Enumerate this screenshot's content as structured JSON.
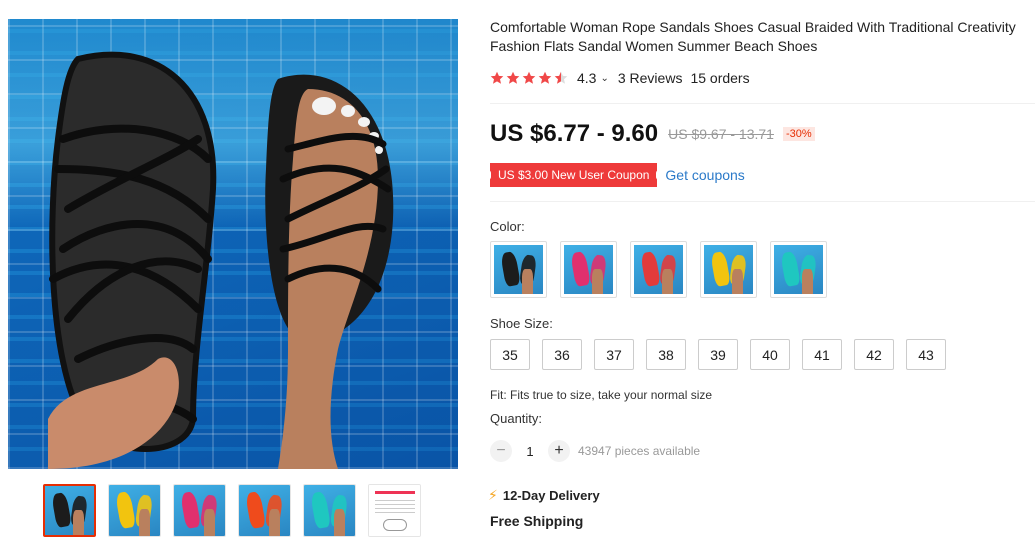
{
  "product": {
    "title_line1": "Comfortable Woman Rope Sandals Shoes Casual Braided With Traditional Creativity",
    "title_line2": "Fashion Flats Sandal Women Summer Beach Shoes",
    "rating": "4.3",
    "rating_stars": 4.5,
    "reviews": "3 Reviews",
    "orders": "15 orders"
  },
  "price": {
    "current": "US $6.77 - 9.60",
    "original": "US $9.67 - 13.71",
    "discount": "-30%"
  },
  "coupon": {
    "badge": "US $3.00 New User Coupon",
    "link": "Get coupons"
  },
  "options": {
    "color_label": "Color:",
    "colors": [
      {
        "name": "black",
        "hex": "#1c1c1c"
      },
      {
        "name": "rose",
        "hex": "#e0306e"
      },
      {
        "name": "red",
        "hex": "#e23b3b"
      },
      {
        "name": "yellow",
        "hex": "#f2c40f"
      },
      {
        "name": "teal",
        "hex": "#1fc7c0"
      }
    ],
    "size_label": "Shoe Size:",
    "sizes": [
      "35",
      "36",
      "37",
      "38",
      "39",
      "40",
      "41",
      "42",
      "43"
    ],
    "fit": "Fit: Fits true to size, take your normal size"
  },
  "quantity": {
    "label": "Quantity:",
    "minus": "−",
    "value": "1",
    "plus": "+",
    "available": "43947 pieces available"
  },
  "shipping": {
    "delivery": "12-Day Delivery",
    "free": "Free Shipping"
  },
  "thumbnails": [
    {
      "name": "black",
      "hex": "#1c1c1c"
    },
    {
      "name": "yellow",
      "hex": "#f2c40f"
    },
    {
      "name": "rose",
      "hex": "#e0306e"
    },
    {
      "name": "orange",
      "hex": "#ef4b1c"
    },
    {
      "name": "teal",
      "hex": "#1fc7c0"
    },
    {
      "name": "size-chart",
      "hex": "#d9d9d9"
    }
  ],
  "theme": {
    "accent": "#e62e04",
    "star": "#f04848",
    "link": "#2b7ac9"
  }
}
